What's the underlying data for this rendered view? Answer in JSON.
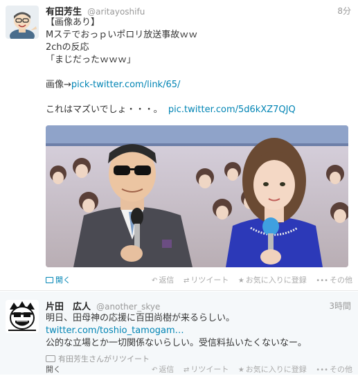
{
  "tweets": [
    {
      "fullname": "有田芳生",
      "username": "@aritayoshifu",
      "time": "8分",
      "lines": [
        "【画像あり】",
        "Mステでおっｐいポロリ放送事故ｗｗ",
        "2chの反応",
        "「まじだったｗｗｗ」"
      ],
      "image_line_prefix": "画像→",
      "image_line_link": "pick-twitter.com/link/65/",
      "last_line_text": "これはマズいでしょ・・・。",
      "last_line_link": "pic.twitter.com/5d6kXZ7QJQ",
      "open_label": "開く",
      "actions": {
        "reply": "返信",
        "retweet": "リツイート",
        "favorite": "お気に入りに登録",
        "more": "その他"
      }
    },
    {
      "fullname": "片田　広人",
      "username": "@another_skye",
      "time": "3時間",
      "line1": "明日、田母神の応援に百田尚樹が来るらしい。",
      "link_line": "twitter.com/toshio_tamogam…",
      "line3": "公的な立場とか一切関係ないらしい。受信料払いたくないなー。",
      "retweeted_by": "有田芳生さんがリツイート",
      "open_label": "開く",
      "actions": {
        "reply": "返信",
        "retweet": "リツイート",
        "favorite": "お気に入りに登録",
        "more": "その他"
      }
    }
  ],
  "colors": {
    "link": "#0084b4",
    "muted": "#999999",
    "text": "#333333"
  }
}
